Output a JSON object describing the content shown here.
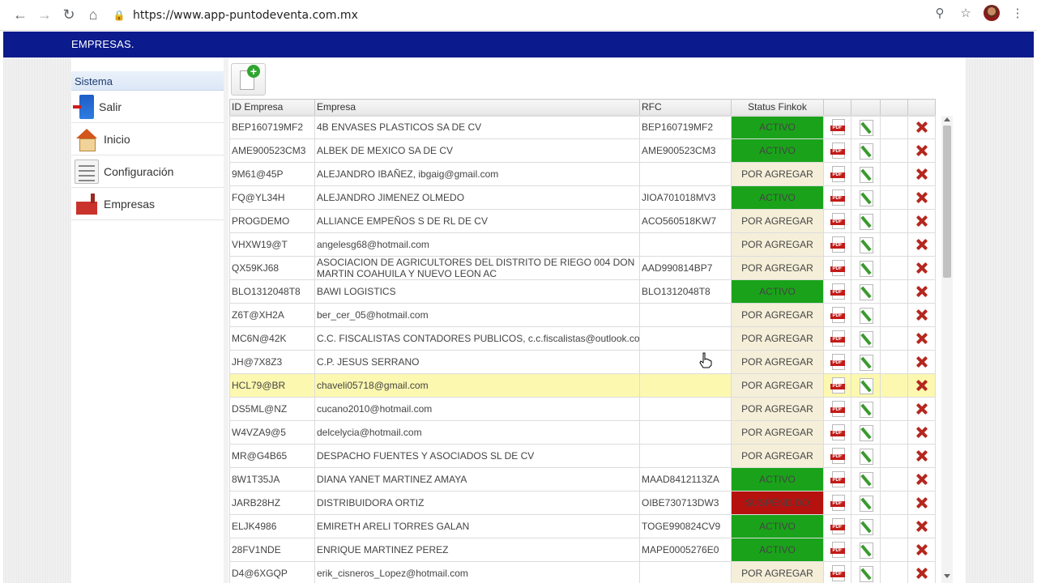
{
  "browser": {
    "url": "https://www.app-puntodeventa.com.mx",
    "icons": [
      "back-icon",
      "forward-icon",
      "reload-icon",
      "home-icon",
      "lock-icon",
      "key-icon",
      "star-icon",
      "avatar",
      "menu-dots-icon"
    ]
  },
  "header": {
    "title": "EMPRESAS."
  },
  "sidebar": {
    "heading": "Sistema",
    "items": [
      {
        "label": "Salir",
        "icon": "exit-door-icon"
      },
      {
        "label": "Inicio",
        "icon": "house-icon"
      },
      {
        "label": "Configuración",
        "icon": "settings-list-icon"
      },
      {
        "label": "Empresas",
        "icon": "factory-icon"
      }
    ]
  },
  "toolbar": {
    "add_icon": "add-document-icon"
  },
  "table": {
    "columns": [
      "ID Empresa",
      "Empresa",
      "RFC",
      "Status Finkok",
      "",
      "",
      "",
      ""
    ],
    "rows": [
      {
        "id": "BEP160719MF2",
        "empresa": "4B ENVASES PLASTICOS SA DE CV",
        "rfc": "BEP160719MF2",
        "status": "ACTIVO"
      },
      {
        "id": "AME900523CM3",
        "empresa": "ALBEK DE MEXICO SA DE CV",
        "rfc": "AME900523CM3",
        "status": "ACTIVO"
      },
      {
        "id": "9M61@45P",
        "empresa": "ALEJANDRO IBAÑEZ, ibgaig@gmail.com",
        "rfc": "",
        "status": "POR AGREGAR"
      },
      {
        "id": "FQ@YL34H",
        "empresa": "ALEJANDRO JIMENEZ OLMEDO",
        "rfc": "JIOA701018MV3",
        "status": "ACTIVO"
      },
      {
        "id": "PROGDEMO",
        "empresa": "ALLIANCE EMPEÑOS S DE RL DE CV",
        "rfc": "ACO560518KW7",
        "status": "POR AGREGAR"
      },
      {
        "id": "VHXW19@T",
        "empresa": "angelesg68@hotmail.com",
        "rfc": "",
        "status": "POR AGREGAR"
      },
      {
        "id": "QX59KJ68",
        "empresa": "ASOCIACION DE AGRICULTORES DEL DISTRITO DE RIEGO 004 DON MARTIN COAHUILA Y NUEVO LEON AC",
        "rfc": "AAD990814BP7",
        "status": "POR AGREGAR"
      },
      {
        "id": "BLO1312048T8",
        "empresa": "BAWI LOGISTICS",
        "rfc": "BLO1312048T8",
        "status": "ACTIVO"
      },
      {
        "id": "Z6T@XH2A",
        "empresa": "ber_cer_05@hotmail.com",
        "rfc": "",
        "status": "POR AGREGAR"
      },
      {
        "id": "MC6N@42K",
        "empresa": "C.C. FISCALISTAS CONTADORES PUBLICOS, c.c.fiscalistas@outlook.com",
        "rfc": "",
        "status": "POR AGREGAR"
      },
      {
        "id": "JH@7X8Z3",
        "empresa": "C.P. JESUS SERRANO",
        "rfc": "",
        "status": "POR AGREGAR"
      },
      {
        "id": "HCL79@BR",
        "empresa": "chaveli05718@gmail.com",
        "rfc": "",
        "status": "POR AGREGAR",
        "highlighted": true
      },
      {
        "id": "DS5ML@NZ",
        "empresa": "cucano2010@hotmail.com",
        "rfc": "",
        "status": "POR AGREGAR"
      },
      {
        "id": "W4VZA9@5",
        "empresa": "delcelycia@hotmail.com",
        "rfc": "",
        "status": "POR AGREGAR"
      },
      {
        "id": "MR@G4B65",
        "empresa": "DESPACHO FUENTES Y ASOCIADOS SL DE CV",
        "rfc": "",
        "status": "POR AGREGAR"
      },
      {
        "id": "8W1T35JA",
        "empresa": "DIANA YANET MARTINEZ AMAYA",
        "rfc": "MAAD8412113ZA",
        "status": "ACTIVO"
      },
      {
        "id": "JARB28HZ",
        "empresa": "DISTRIBUIDORA ORTIZ",
        "rfc": "OIBE730713DW3",
        "status": "SUSPENDIDO"
      },
      {
        "id": "ELJK4986",
        "empresa": "EMIRETH ARELI TORRES GALAN",
        "rfc": "TOGE990824CV9",
        "status": "ACTIVO"
      },
      {
        "id": "28FV1NDE",
        "empresa": "ENRIQUE MARTINEZ PEREZ",
        "rfc": "MAPE0005276E0",
        "status": "ACTIVO"
      },
      {
        "id": "D4@6XGQP",
        "empresa": "erik_cisneros_Lopez@hotmail.com",
        "rfc": "",
        "status": "POR AGREGAR"
      }
    ],
    "status_colors": {
      "ACTIVO": "#1aa31a",
      "POR AGREGAR": "#f5efd9",
      "SUSPENDIDO": "#b5120f"
    },
    "row_icons": [
      "pdf-icon",
      "edit-icon",
      "",
      "delete-icon"
    ]
  },
  "colors": {
    "header_bg": "#0b1a8c",
    "highlight_row": "#fcf8b0"
  }
}
